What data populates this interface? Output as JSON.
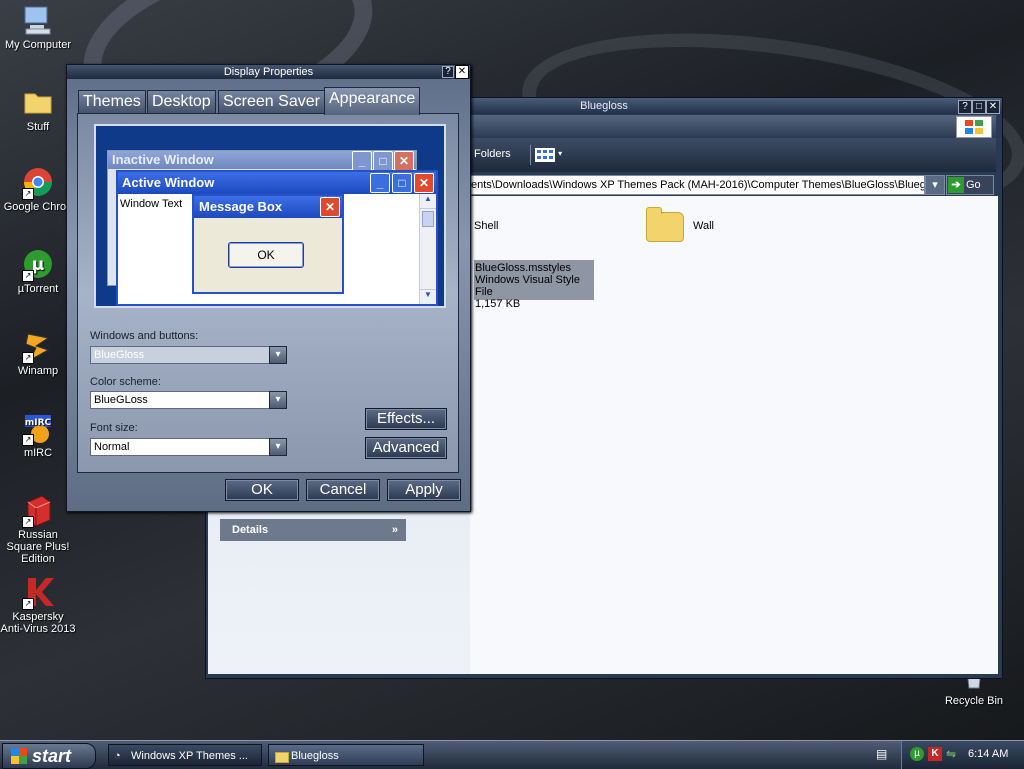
{
  "desktop": {
    "icons": [
      {
        "label": "My Computer",
        "icon": "computer-icon"
      },
      {
        "label": "Stuff",
        "icon": "folder-icon"
      },
      {
        "label": "Google Chron",
        "icon": "chrome-icon"
      },
      {
        "label": "µTorrent",
        "icon": "utorrent-icon"
      },
      {
        "label": "Winamp",
        "icon": "winamp-icon"
      },
      {
        "label": "mIRC",
        "icon": "mirc-icon"
      },
      {
        "label": "Russian Square Plus! Edition",
        "icon": "russian-square-icon"
      },
      {
        "label": "Kaspersky Anti-Virus 2013",
        "icon": "kaspersky-icon"
      },
      {
        "label": "Recycle Bin",
        "icon": "recycle-bin-icon"
      }
    ]
  },
  "explorer": {
    "title": "Bluegloss",
    "toolbar": {
      "folders_label": "Folders"
    },
    "address": {
      "path": "ents\\Downloads\\Windows XP Themes Pack (MAH-2016)\\Computer Themes\\BlueGloss\\Bluegloss",
      "go_label": "Go"
    },
    "files": [
      {
        "name": "Shell"
      },
      {
        "name": "Wall"
      }
    ],
    "selected_file": {
      "name": "BlueGloss.msstyles",
      "type": "Windows Visual Style File",
      "size": "1,157 KB"
    },
    "details_label": "Details"
  },
  "dialog": {
    "title": "Display Properties",
    "tabs": [
      "Themes",
      "Desktop",
      "Screen Saver",
      "Appearance"
    ],
    "active_tab": "Appearance",
    "preview": {
      "inactive_title": "Inactive Window",
      "active_title": "Active Window",
      "window_text": "Window Text",
      "message_box_title": "Message Box",
      "ok_label": "OK"
    },
    "windows_buttons_label": "Windows and buttons:",
    "windows_buttons_value": "BlueGloss",
    "color_scheme_label": "Color scheme:",
    "color_scheme_value": "BlueGLoss",
    "font_size_label": "Font size:",
    "font_size_value": "Normal",
    "effects_label": "Effects...",
    "advanced_label": "Advanced",
    "ok_label": "OK",
    "cancel_label": "Cancel",
    "apply_label": "Apply"
  },
  "taskbar": {
    "start_label": "start",
    "tasks": [
      "Windows XP Themes ...",
      "Bluegloss"
    ],
    "clock": "6:14 AM"
  },
  "colors": {
    "accent": "#2551c8",
    "taskbar": "#2c3850"
  }
}
